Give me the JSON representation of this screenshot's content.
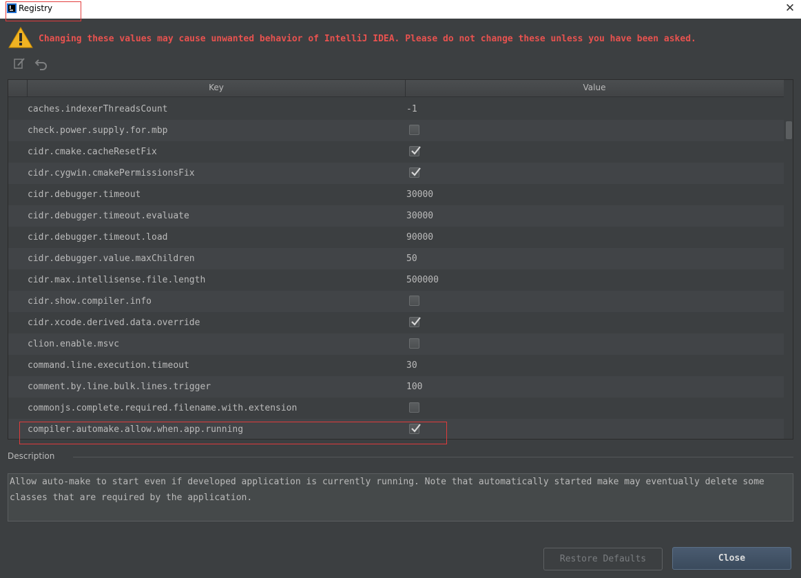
{
  "window": {
    "title": "Registry",
    "close_glyph": "✕"
  },
  "warning": {
    "icon": "warning-icon",
    "text": "Changing these values may cause unwanted behavior of IntelliJ IDEA. Please do not change these unless you have been asked."
  },
  "toolbar": {
    "icons": [
      "edit-icon",
      "revert-icon"
    ]
  },
  "table": {
    "columns": {
      "key": "Key",
      "value": "Value"
    },
    "rows": [
      {
        "key": "caches.indexerThreadsCount",
        "type": "text",
        "value": "-1"
      },
      {
        "key": "check.power.supply.for.mbp",
        "type": "checkbox",
        "checked": false
      },
      {
        "key": "cidr.cmake.cacheResetFix",
        "type": "checkbox",
        "checked": true
      },
      {
        "key": "cidr.cygwin.cmakePermissionsFix",
        "type": "checkbox",
        "checked": true
      },
      {
        "key": "cidr.debugger.timeout",
        "type": "text",
        "value": "30000"
      },
      {
        "key": "cidr.debugger.timeout.evaluate",
        "type": "text",
        "value": "30000"
      },
      {
        "key": "cidr.debugger.timeout.load",
        "type": "text",
        "value": "90000"
      },
      {
        "key": "cidr.debugger.value.maxChildren",
        "type": "text",
        "value": "50"
      },
      {
        "key": "cidr.max.intellisense.file.length",
        "type": "text",
        "value": "500000"
      },
      {
        "key": "cidr.show.compiler.info",
        "type": "checkbox",
        "checked": false
      },
      {
        "key": "cidr.xcode.derived.data.override",
        "type": "checkbox",
        "checked": true
      },
      {
        "key": "clion.enable.msvc",
        "type": "checkbox",
        "checked": false
      },
      {
        "key": "command.line.execution.timeout",
        "type": "text",
        "value": "30"
      },
      {
        "key": "comment.by.line.bulk.lines.trigger",
        "type": "text",
        "value": "100"
      },
      {
        "key": "commonjs.complete.required.filename.with.extension",
        "type": "checkbox",
        "checked": false
      },
      {
        "key": "compiler.automake.allow.when.app.running",
        "type": "checkbox",
        "checked": true
      }
    ]
  },
  "description": {
    "label": "Description",
    "text": "Allow auto-make to start even if developed application is currently running. Note that automatically started make may eventually delete some classes that are required by the application."
  },
  "buttons": {
    "restore": "Restore Defaults",
    "close": "Close"
  },
  "colors": {
    "warning_text": "#e8524f",
    "highlight_frame": "#e23b3b"
  }
}
